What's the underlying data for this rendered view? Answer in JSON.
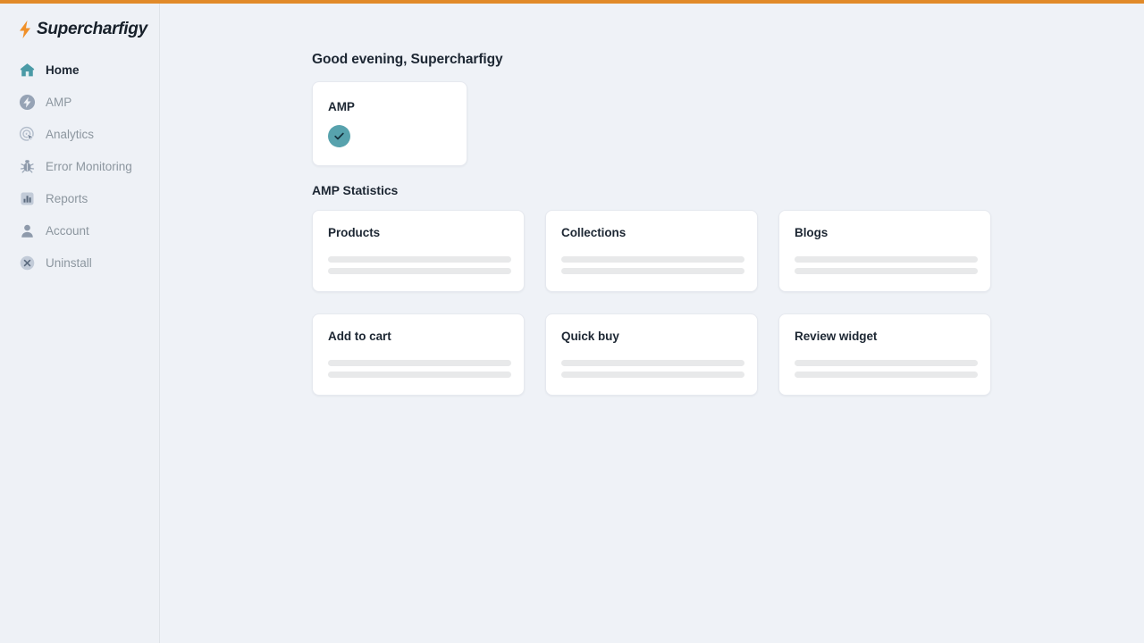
{
  "theme": {
    "accent_bar": "#e18a29",
    "sidebar_bg": "#eef1f6",
    "main_bg": "#eff2f7",
    "card_bg": "#ffffff",
    "text_primary": "#1d2733",
    "text_muted": "#8c969f",
    "status_teal": "#57a2ad",
    "skeleton": "#e8e9ea",
    "icon_muted": "#8e9aab",
    "icon_active": "#3f8f9c"
  },
  "sidebar": {
    "brand": {
      "name": "Supercharfigy",
      "icon": "lightning-bolt-icon"
    },
    "items": [
      {
        "label": "Home",
        "icon": "home-icon",
        "active": true
      },
      {
        "label": "AMP",
        "icon": "amp-bolt-icon",
        "active": false
      },
      {
        "label": "Analytics",
        "icon": "analytics-icon",
        "active": false
      },
      {
        "label": "Error Monitoring",
        "icon": "bug-icon",
        "active": false
      },
      {
        "label": "Reports",
        "icon": "bar-chart-icon",
        "active": false
      },
      {
        "label": "Account",
        "icon": "user-icon",
        "active": false
      },
      {
        "label": "Uninstall",
        "icon": "close-circle-icon",
        "active": false
      }
    ]
  },
  "main": {
    "greeting": "Good evening, Supercharfigy",
    "amp_status_card": {
      "title": "AMP",
      "status_icon": "check-circle-icon",
      "status": "enabled"
    },
    "statistics": {
      "section_title": "AMP Statistics",
      "cards": [
        {
          "title": "Products",
          "loading": true
        },
        {
          "title": "Collections",
          "loading": true
        },
        {
          "title": "Blogs",
          "loading": true
        },
        {
          "title": "Add to cart",
          "loading": true
        },
        {
          "title": "Quick buy",
          "loading": true
        },
        {
          "title": "Review widget",
          "loading": true
        }
      ]
    }
  }
}
